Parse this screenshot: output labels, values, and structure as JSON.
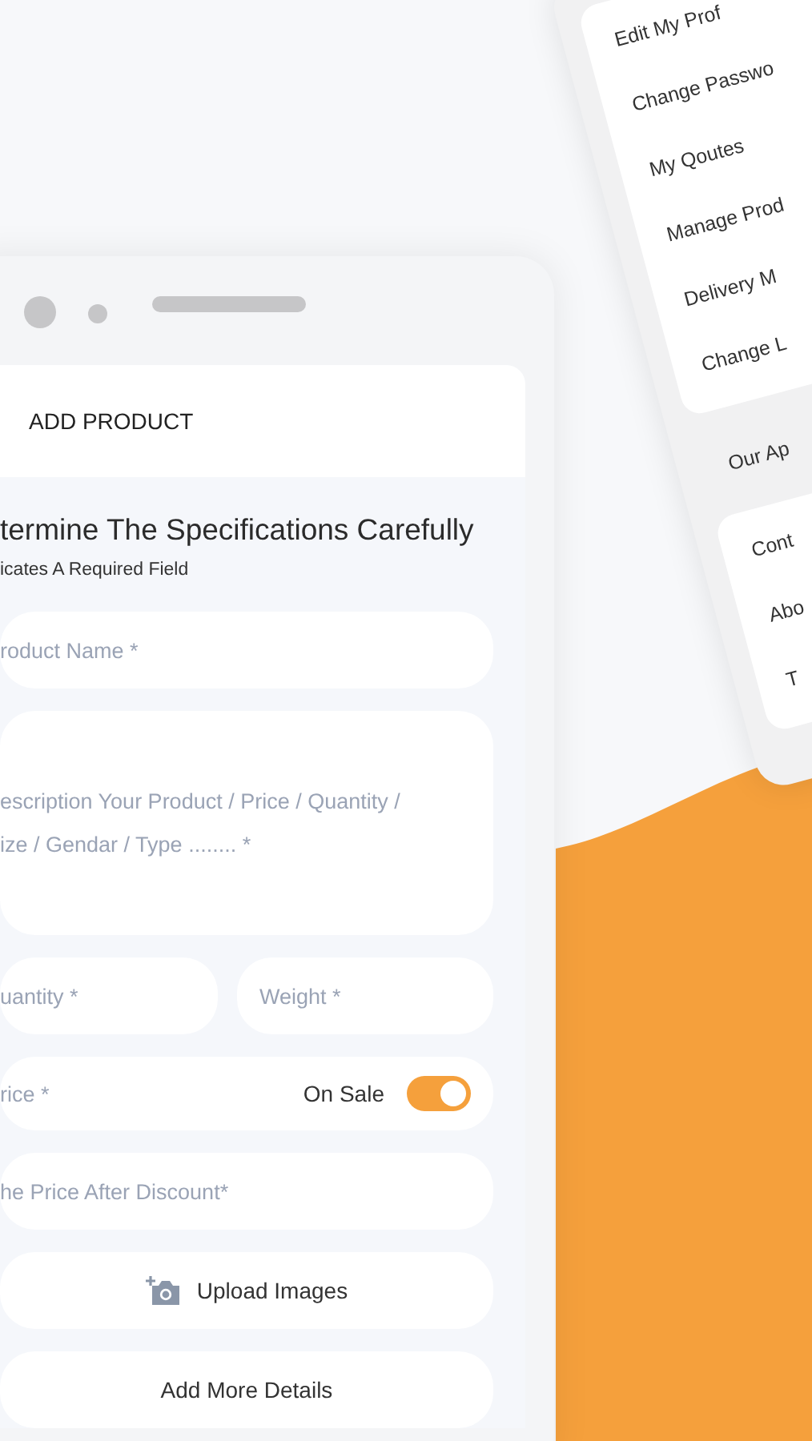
{
  "add_product_screen": {
    "header": {
      "title": "ADD PRODUCT"
    },
    "heading": "termine The Specifications Carefully",
    "note": "icates A Required Field",
    "rows": [
      {
        "kind": "field",
        "placeholder": "roduct Name *"
      },
      {
        "kind": "textarea",
        "placeholder": "escription Your Product / Price / Quantity /\nize / Gendar / Type ........ *"
      },
      {
        "kind": "pair",
        "fields": [
          {
            "placeholder": "uantity *"
          },
          {
            "placeholder": "Weight *"
          }
        ]
      },
      {
        "kind": "price",
        "placeholder": "rice *",
        "toggle": {
          "label": "On Sale",
          "on": true
        }
      },
      {
        "kind": "field",
        "placeholder": "he Price After Discount*"
      },
      {
        "kind": "upload",
        "label": "Upload Images"
      },
      {
        "kind": "button",
        "label": "Add More Details"
      }
    ]
  },
  "menu_screen": {
    "groups": [
      {
        "kind": "card",
        "items": [
          "Edit My Prof",
          "Change Passwo",
          "My Qoutes",
          "Manage Prod",
          "Delivery M",
          "Change L"
        ]
      },
      {
        "kind": "band",
        "items": [
          "Our Ap"
        ]
      },
      {
        "kind": "card",
        "items": [
          "Cont",
          "Abo",
          "T"
        ]
      }
    ]
  }
}
